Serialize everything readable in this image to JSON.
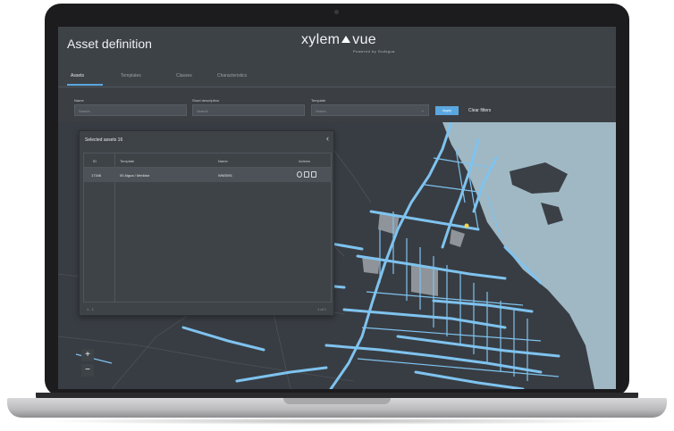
{
  "header": {
    "title": "Asset definition",
    "brand_left": "xylem",
    "brand_right": "vue",
    "brand_sub": "Powered by GoAigua"
  },
  "tabs": [
    {
      "label": "Assets",
      "active": true
    },
    {
      "label": "Templates",
      "active": false
    },
    {
      "label": "Classes",
      "active": false
    },
    {
      "label": "Characteristics",
      "active": false
    }
  ],
  "filters": {
    "name_label": "Name",
    "name_placeholder": "Search",
    "desc_label": "Short description",
    "desc_placeholder": "Search",
    "template_label": "Template",
    "template_placeholder": "Select...",
    "apply_label": "Apply",
    "clear_label": "Clear filters"
  },
  "panel": {
    "title": "Selected assets 16",
    "columns": [
      "ID",
      "Template",
      "Name",
      "Actions"
    ],
    "rows": [
      {
        "id": "17346",
        "template": "00 Aigua / Medidor",
        "name": "WM3591"
      }
    ],
    "pager_left": "1 - 1",
    "pager_right": "1  of 1"
  },
  "map": {
    "zoom_in": "+",
    "zoom_out": "−",
    "land_color": "#383d43",
    "water_color": "#9fb8c4",
    "network_color": "#7fc3ef",
    "highlight_color": "#f2d54b"
  }
}
